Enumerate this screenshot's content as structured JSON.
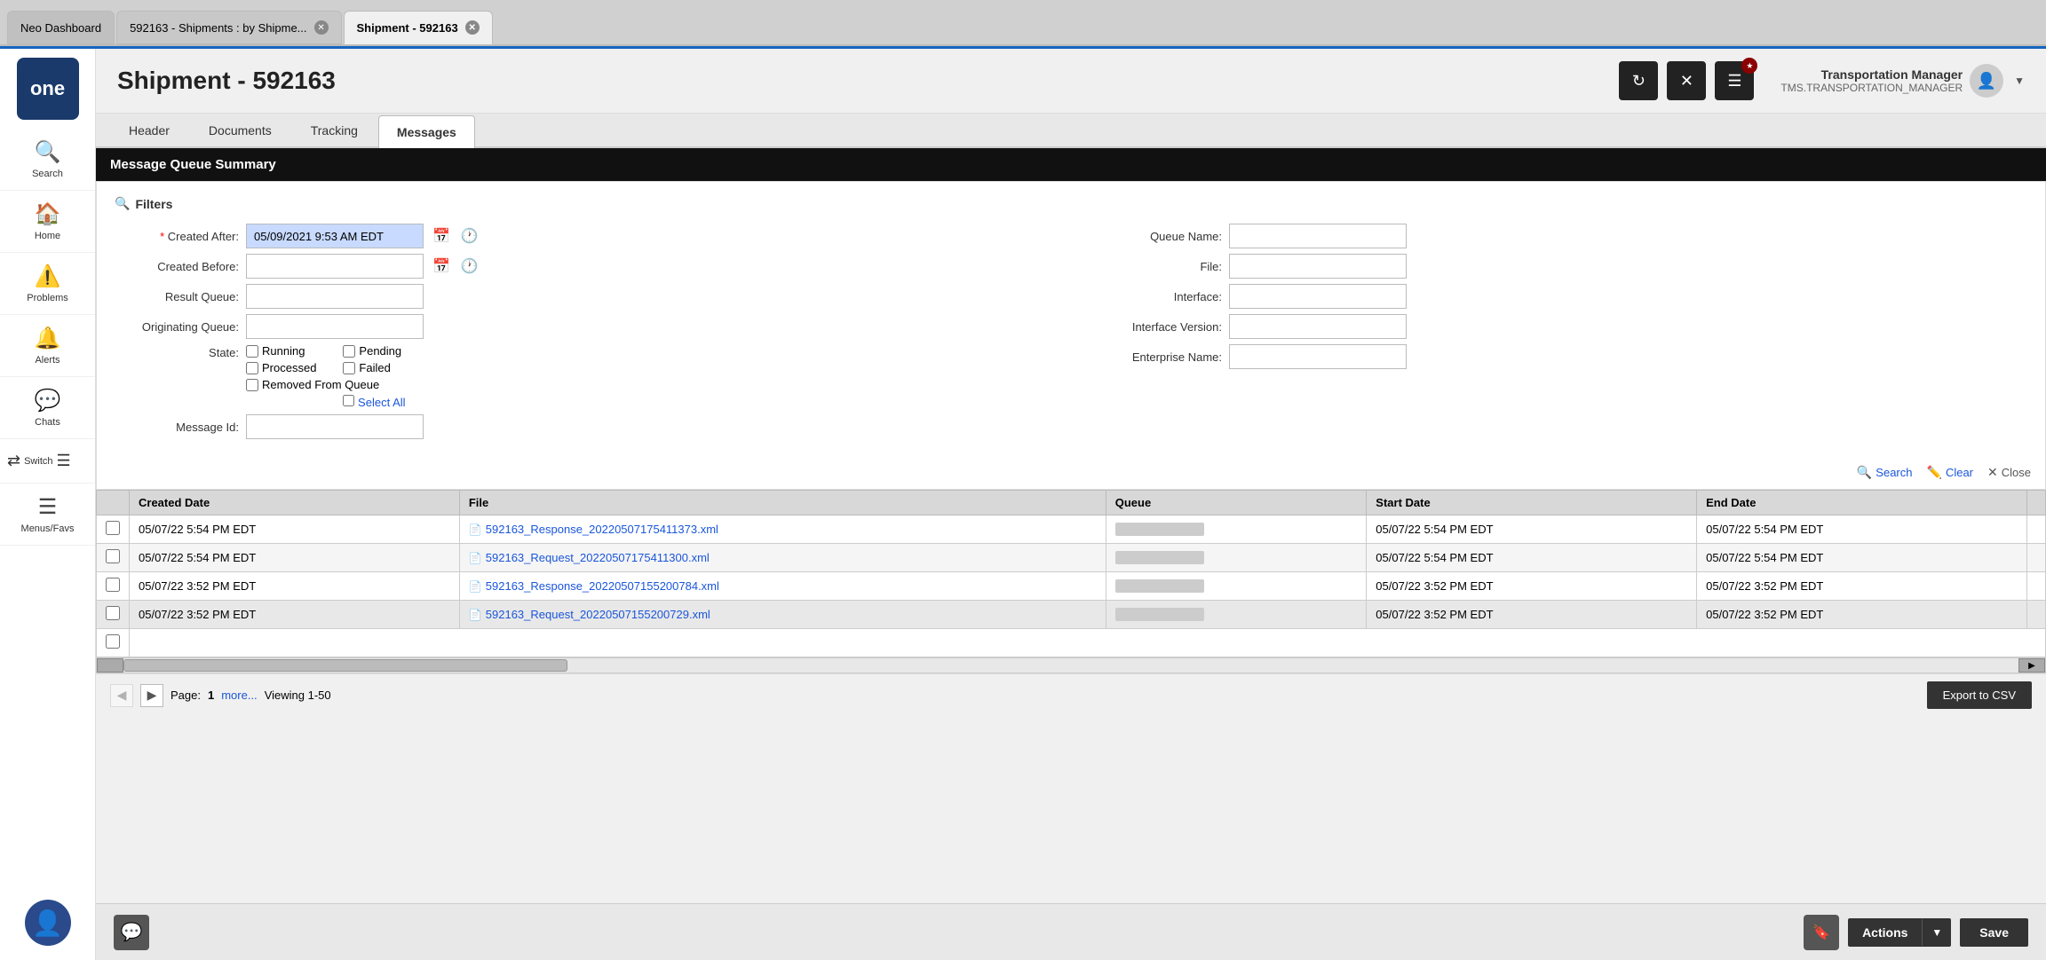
{
  "browser": {
    "tabs": [
      {
        "label": "Neo Dashboard",
        "active": false
      },
      {
        "label": "592163 - Shipments : by Shipme...",
        "active": false
      },
      {
        "label": "Shipment - 592163",
        "active": true
      }
    ]
  },
  "header": {
    "title": "Shipment - 592163",
    "user_name": "Transportation Manager",
    "user_role": "TMS.TRANSPORTATION_MANAGER"
  },
  "tabs": [
    {
      "label": "Header",
      "active": false
    },
    {
      "label": "Documents",
      "active": false
    },
    {
      "label": "Tracking",
      "active": false
    },
    {
      "label": "Messages",
      "active": true
    }
  ],
  "mqs": {
    "title": "Message Queue Summary"
  },
  "filters": {
    "title": "Filters",
    "created_after_label": "Created After:",
    "created_after_value": "05/09/2021 9:53 AM EDT",
    "created_before_label": "Created Before:",
    "result_queue_label": "Result Queue:",
    "originating_queue_label": "Originating Queue:",
    "state_label": "State:",
    "state_options": [
      "Running",
      "Pending",
      "Processed",
      "Failed",
      "Removed From Queue"
    ],
    "select_all_label": "Select All",
    "message_id_label": "Message Id:",
    "queue_name_label": "Queue Name:",
    "file_label": "File:",
    "interface_label": "Interface:",
    "interface_version_label": "Interface Version:",
    "enterprise_name_label": "Enterprise Name:",
    "search_btn": "Search",
    "clear_btn": "Clear",
    "close_btn": "Close"
  },
  "table": {
    "columns": [
      "",
      "Created Date",
      "File",
      "Queue",
      "Start Date",
      "End Date",
      ""
    ],
    "rows": [
      {
        "created": "05/07/22 5:54 PM EDT",
        "file": "592163_Response_20220507175411373.xml",
        "queue": "",
        "start": "05/07/22 5:54 PM EDT",
        "end": "05/07/22 5:54 PM EDT",
        "selected": false
      },
      {
        "created": "05/07/22 5:54 PM EDT",
        "file": "592163_Request_20220507175411300.xml",
        "queue": "",
        "start": "05/07/22 5:54 PM EDT",
        "end": "05/07/22 5:54 PM EDT",
        "selected": false
      },
      {
        "created": "05/07/22 3:52 PM EDT",
        "file": "592163_Response_20220507155200784.xml",
        "queue": "",
        "start": "05/07/22 3:52 PM EDT",
        "end": "05/07/22 3:52 PM EDT",
        "selected": false
      },
      {
        "created": "05/07/22 3:52 PM EDT",
        "file": "592163_Request_20220507155200729.xml",
        "queue": "",
        "start": "05/07/22 3:52 PM EDT",
        "end": "05/07/22 3:52 PM EDT",
        "selected": false
      }
    ]
  },
  "pagination": {
    "page": "1",
    "more": "more...",
    "viewing": "Viewing 1-50",
    "export_btn": "Export to CSV"
  },
  "bottom_bar": {
    "actions_label": "Actions",
    "save_label": "Save"
  },
  "sidebar": {
    "items": [
      {
        "label": "Search",
        "icon": "🔍"
      },
      {
        "label": "Home",
        "icon": "🏠"
      },
      {
        "label": "Problems",
        "icon": "⚠️"
      },
      {
        "label": "Alerts",
        "icon": "🔔"
      },
      {
        "label": "Chats",
        "icon": "💬"
      },
      {
        "label": "Switch",
        "icon": "⇄"
      },
      {
        "label": "Menus/Favs",
        "icon": "☰"
      }
    ]
  }
}
